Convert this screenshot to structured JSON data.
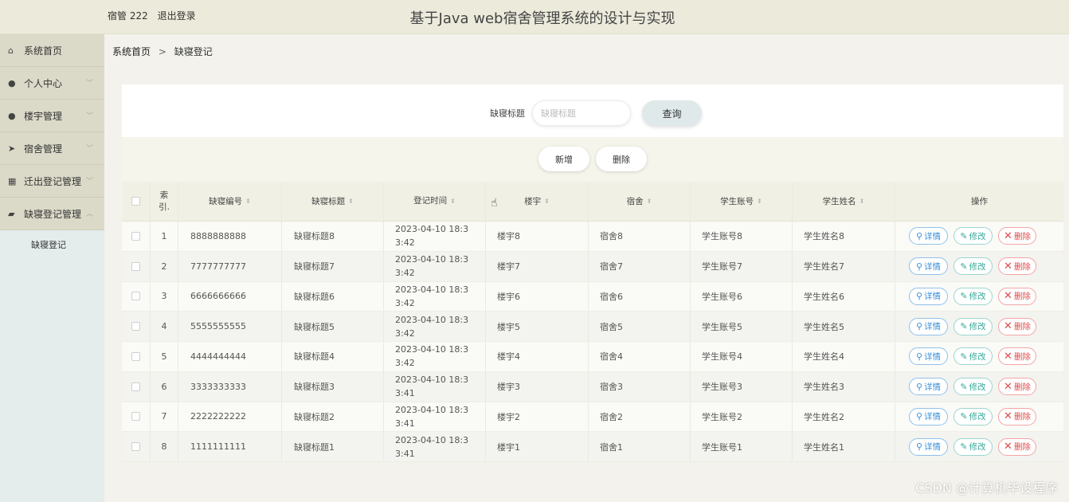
{
  "header": {
    "user_label": "宿管 222",
    "logout_label": "退出登录",
    "app_title": "基于Java web宿舍管理系统的设计与实现"
  },
  "sidebar": {
    "items": [
      {
        "label": "系统首页",
        "icon": "home-icon",
        "glyph": "⌂",
        "has_chevron": false
      },
      {
        "label": "个人中心",
        "icon": "user-icon",
        "glyph": "●",
        "has_chevron": true
      },
      {
        "label": "楼宇管理",
        "icon": "user-icon",
        "glyph": "●",
        "has_chevron": true
      },
      {
        "label": "宿舍管理",
        "icon": "send-icon",
        "glyph": "➤",
        "has_chevron": true
      },
      {
        "label": "迁出登记管理",
        "icon": "grid-icon",
        "glyph": "▦",
        "has_chevron": true
      },
      {
        "label": "缺寝登记管理",
        "icon": "folder-icon",
        "glyph": "▰",
        "has_chevron": true
      }
    ],
    "submenu_label": "缺寝登记"
  },
  "breadcrumb": {
    "home": "系统首页",
    "separator": ">",
    "current": "缺寝登记"
  },
  "search": {
    "label": "缺寝标题",
    "placeholder": "缺寝标题",
    "query_button": "查询"
  },
  "toolbar": {
    "add_label": "新增",
    "delete_label": "删除"
  },
  "table": {
    "columns": {
      "index": "索引.",
      "no": "缺寝编号",
      "title": "缺寝标题",
      "time": "登记时间",
      "building": "楼宇",
      "room": "宿舍",
      "account": "学生账号",
      "name": "学生姓名",
      "ops": "操作"
    },
    "ops": {
      "detail": "详情",
      "edit": "修改",
      "delete": "删除"
    },
    "rows": [
      {
        "index": "1",
        "no": "8888888888",
        "title": "缺寝标题8",
        "time": "2023-04-10 18:33:42",
        "building": "楼宇8",
        "room": "宿舍8",
        "account": "学生账号8",
        "name": "学生姓名8"
      },
      {
        "index": "2",
        "no": "7777777777",
        "title": "缺寝标题7",
        "time": "2023-04-10 18:33:42",
        "building": "楼宇7",
        "room": "宿舍7",
        "account": "学生账号7",
        "name": "学生姓名7"
      },
      {
        "index": "3",
        "no": "6666666666",
        "title": "缺寝标题6",
        "time": "2023-04-10 18:33:42",
        "building": "楼宇6",
        "room": "宿舍6",
        "account": "学生账号6",
        "name": "学生姓名6"
      },
      {
        "index": "4",
        "no": "5555555555",
        "title": "缺寝标题5",
        "time": "2023-04-10 18:33:42",
        "building": "楼宇5",
        "room": "宿舍5",
        "account": "学生账号5",
        "name": "学生姓名5"
      },
      {
        "index": "5",
        "no": "4444444444",
        "title": "缺寝标题4",
        "time": "2023-04-10 18:33:42",
        "building": "楼宇4",
        "room": "宿舍4",
        "account": "学生账号4",
        "name": "学生姓名4"
      },
      {
        "index": "6",
        "no": "3333333333",
        "title": "缺寝标题3",
        "time": "2023-04-10 18:33:41",
        "building": "楼宇3",
        "room": "宿舍3",
        "account": "学生账号3",
        "name": "学生姓名3"
      },
      {
        "index": "7",
        "no": "2222222222",
        "title": "缺寝标题2",
        "time": "2023-04-10 18:33:41",
        "building": "楼宇2",
        "room": "宿舍2",
        "account": "学生账号2",
        "name": "学生姓名2"
      },
      {
        "index": "8",
        "no": "1111111111",
        "title": "缺寝标题1",
        "time": "2023-04-10 18:33:41",
        "building": "楼宇1",
        "room": "宿舍1",
        "account": "学生账号1",
        "name": "学生姓名1"
      }
    ]
  },
  "watermark": "CSDN @计算机毕设程序"
}
